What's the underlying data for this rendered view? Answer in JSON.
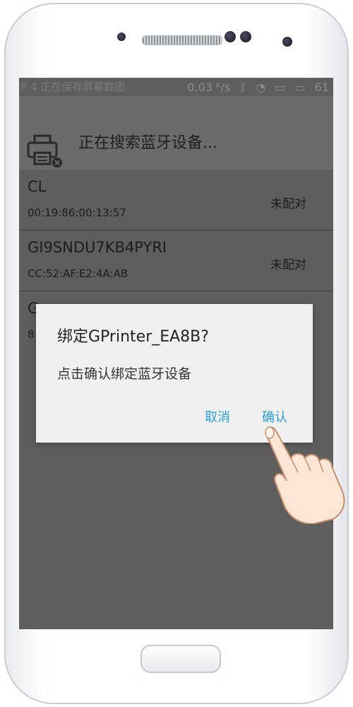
{
  "status_bar": {
    "left_text": "P 4 正在保存屏幕截图",
    "speed": "0.03 ᴷ/s",
    "battery_level": "61"
  },
  "app_bar": {
    "title": "正在搜索蓝牙设备..."
  },
  "devices": [
    {
      "name": "CL",
      "mac": "00:19:86:00:13:57",
      "status": "未配对"
    },
    {
      "name": "GI9SNDU7KB4PYRI",
      "mac": "CC:52:AF:E2:4A:AB",
      "status": "未配对"
    },
    {
      "name": "G",
      "mac": "8",
      "status": ""
    }
  ],
  "dialog": {
    "title": "绑定GPrinter_EA8B?",
    "message": "点击确认绑定蓝牙设备",
    "cancel_label": "取消",
    "confirm_label": "确认"
  },
  "colors": {
    "accent": "#2a9fd6",
    "overlay": "#5e5e5e"
  },
  "icons": [
    "printer-icon",
    "bluetooth-icon",
    "wifi-icon",
    "battery-icon",
    "pointing-hand-icon"
  ]
}
